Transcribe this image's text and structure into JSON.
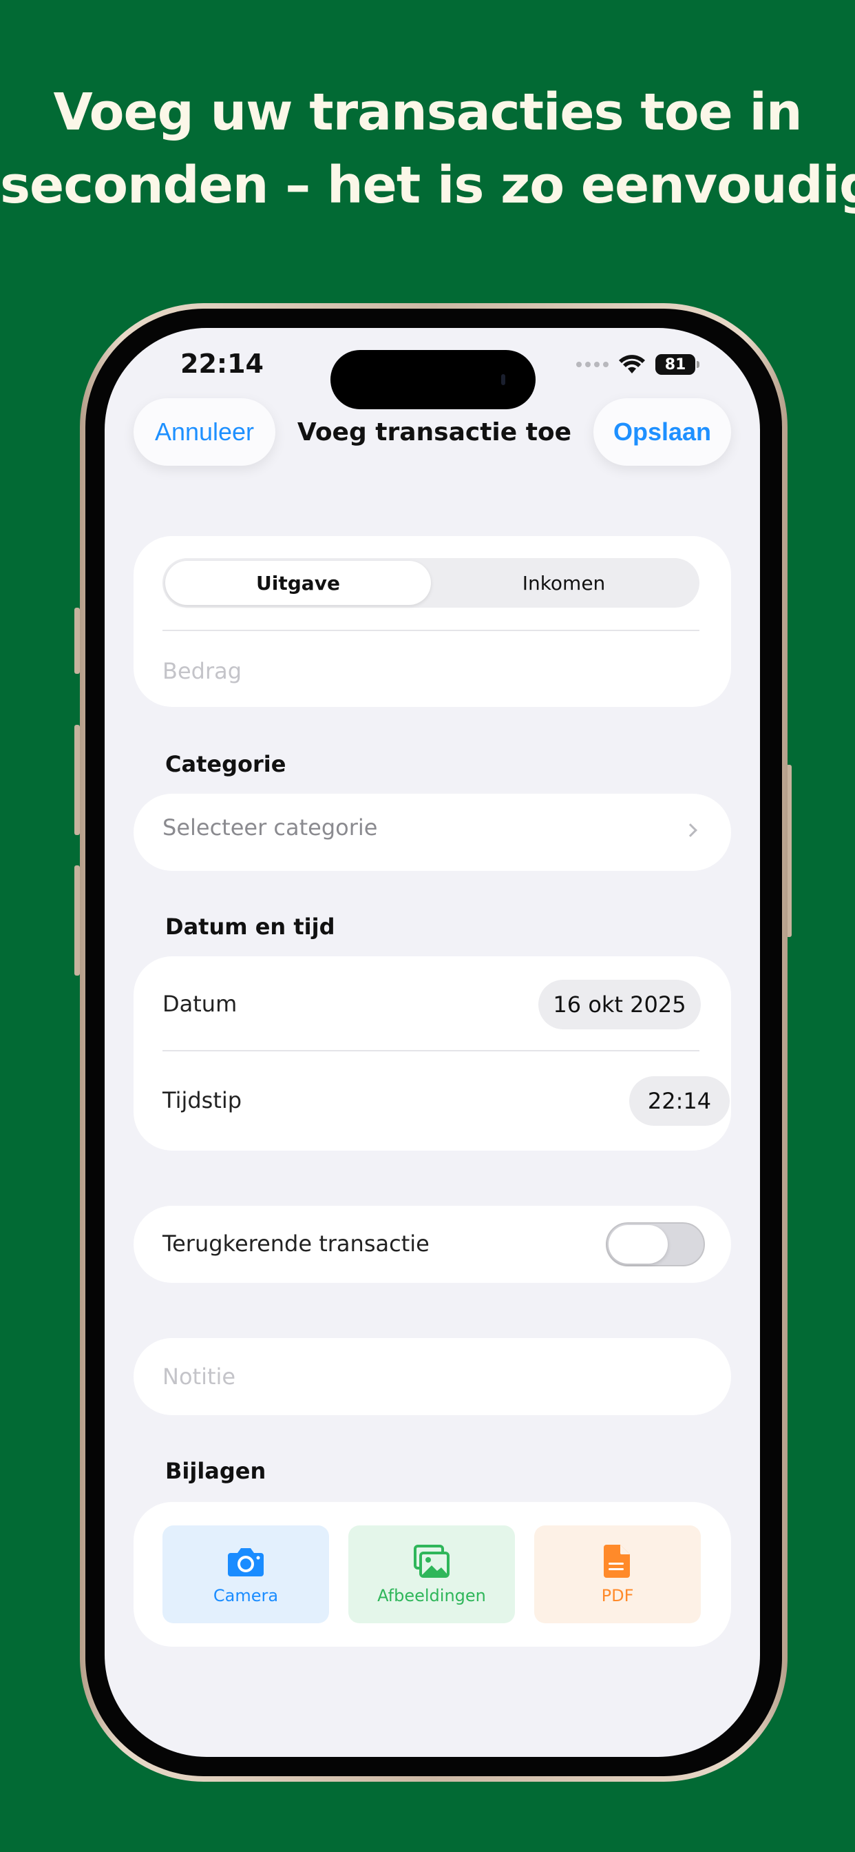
{
  "headline": {
    "line1": "Voeg uw transacties toe in",
    "line2": "seconden – het is zo eenvoudig!"
  },
  "status_bar": {
    "time": "22:14",
    "battery": "81"
  },
  "nav": {
    "cancel_label": "Annuleer",
    "title": "Voeg transactie toe",
    "save_label": "Opslaan"
  },
  "type_selector": {
    "options": [
      "Uitgave",
      "Inkomen"
    ],
    "selected": "Uitgave"
  },
  "amount": {
    "placeholder": "Bedrag"
  },
  "category": {
    "section_title": "Categorie",
    "placeholder": "Selecteer categorie"
  },
  "datetime": {
    "section_title": "Datum en tijd",
    "date_label": "Datum",
    "date_value": "16 okt 2025",
    "time_label": "Tijdstip",
    "time_value": "22:14"
  },
  "recurring": {
    "label": "Terugkerende transactie",
    "enabled": false
  },
  "note": {
    "placeholder": "Notitie"
  },
  "attachments": {
    "section_title": "Bijlagen",
    "items": [
      {
        "label": "Camera",
        "icon": "camera-icon",
        "color": "#1a8cff",
        "bg": "#e3f0fd"
      },
      {
        "label": "Afbeeldingen",
        "icon": "photos-icon",
        "color": "#2fb65a",
        "bg": "#e4f6ea"
      },
      {
        "label": "PDF",
        "icon": "document-icon",
        "color": "#ff8a2a",
        "bg": "#fdf1e6"
      }
    ]
  },
  "colors": {
    "background": "#026a34",
    "accent": "#1e90ff",
    "headline": "#fbf7e8"
  }
}
